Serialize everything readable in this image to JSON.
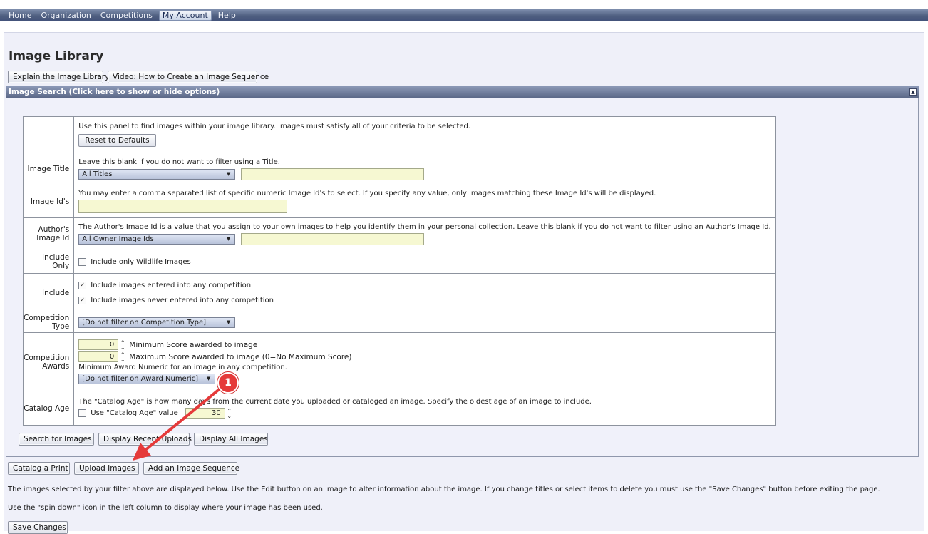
{
  "menu": [
    "Home",
    "Organization",
    "Competitions",
    "My Account",
    "Help"
  ],
  "page_title": "Image Library",
  "top_buttons": {
    "explain": "Explain the Image Library",
    "video": "Video: How to Create an Image Sequence"
  },
  "panel": {
    "header": "Image Search (Click here to show or hide options)",
    "collapse_icon": "▲"
  },
  "criteria": {
    "intro_note": "Use this panel to find images within your image library. Images must satisfy all of your criteria to be selected.",
    "reset_button": "Reset to Defaults",
    "title": {
      "label": "Image Title",
      "note": "Leave this blank if you do not want to filter using a Title.",
      "select_value": "All Titles",
      "text_value": ""
    },
    "ids": {
      "label": "Image Id's",
      "note": "You may enter a comma separated list of specific numeric Image Id's to select. If you specify any value, only images matching these Image Id's will be displayed.",
      "text_value": ""
    },
    "author_id": {
      "label": "Author's Image Id",
      "note": "The Author's Image Id is a value that you assign to your own images to help you identify them in your personal collection. Leave this blank if you do not want to filter using an Author's Image Id.",
      "select_value": "All Owner Image Ids",
      "text_value": ""
    },
    "include_only": {
      "label": "Include Only",
      "option": "Include only Wildlife Images",
      "checked": false
    },
    "include": {
      "label": "Include",
      "option_entered": "Include images entered into any competition",
      "option_never": "Include images never entered into any competition",
      "checked_entered": true,
      "checked_never": true
    },
    "competition_type": {
      "label": "Competition Type",
      "select_value": "[Do not filter on Competition Type]"
    },
    "awards": {
      "label": "Competition Awards",
      "min_value": "0",
      "min_label": "Minimum Score awarded to image",
      "max_value": "0",
      "max_label": "Maximum Score awarded to image (0=No Maximum Score)",
      "numeric_note": "Minimum Award Numeric for an image in any competition.",
      "numeric_select": "[Do not filter on Award Numeric]"
    },
    "catalog_age": {
      "label": "Catalog Age",
      "note": "The \"Catalog Age\" is how many days from the current date you uploaded or cataloged an image. Specify the oldest age of an image to include.",
      "option": "Use \"Catalog Age\" value",
      "checked": false,
      "value": "30"
    }
  },
  "search_buttons": {
    "search": "Search for Images",
    "recent": "Display Recent Uploads",
    "all": "Display All Images"
  },
  "action_buttons": {
    "catalog": "Catalog a Print",
    "upload": "Upload Images",
    "sequence": "Add an Image Sequence"
  },
  "info_text_1": "The images selected by your filter above are displayed below. Use the Edit button on an image to alter information about the image. If you change titles or select items to delete you must use the \"Save Changes\" button before exiting the page.",
  "info_text_2": "Use the \"spin down\" icon in the left column to display where your image has been used.",
  "save_button": "Save Changes",
  "annotation": {
    "badge_number": "1",
    "color": "#e53a3a"
  }
}
